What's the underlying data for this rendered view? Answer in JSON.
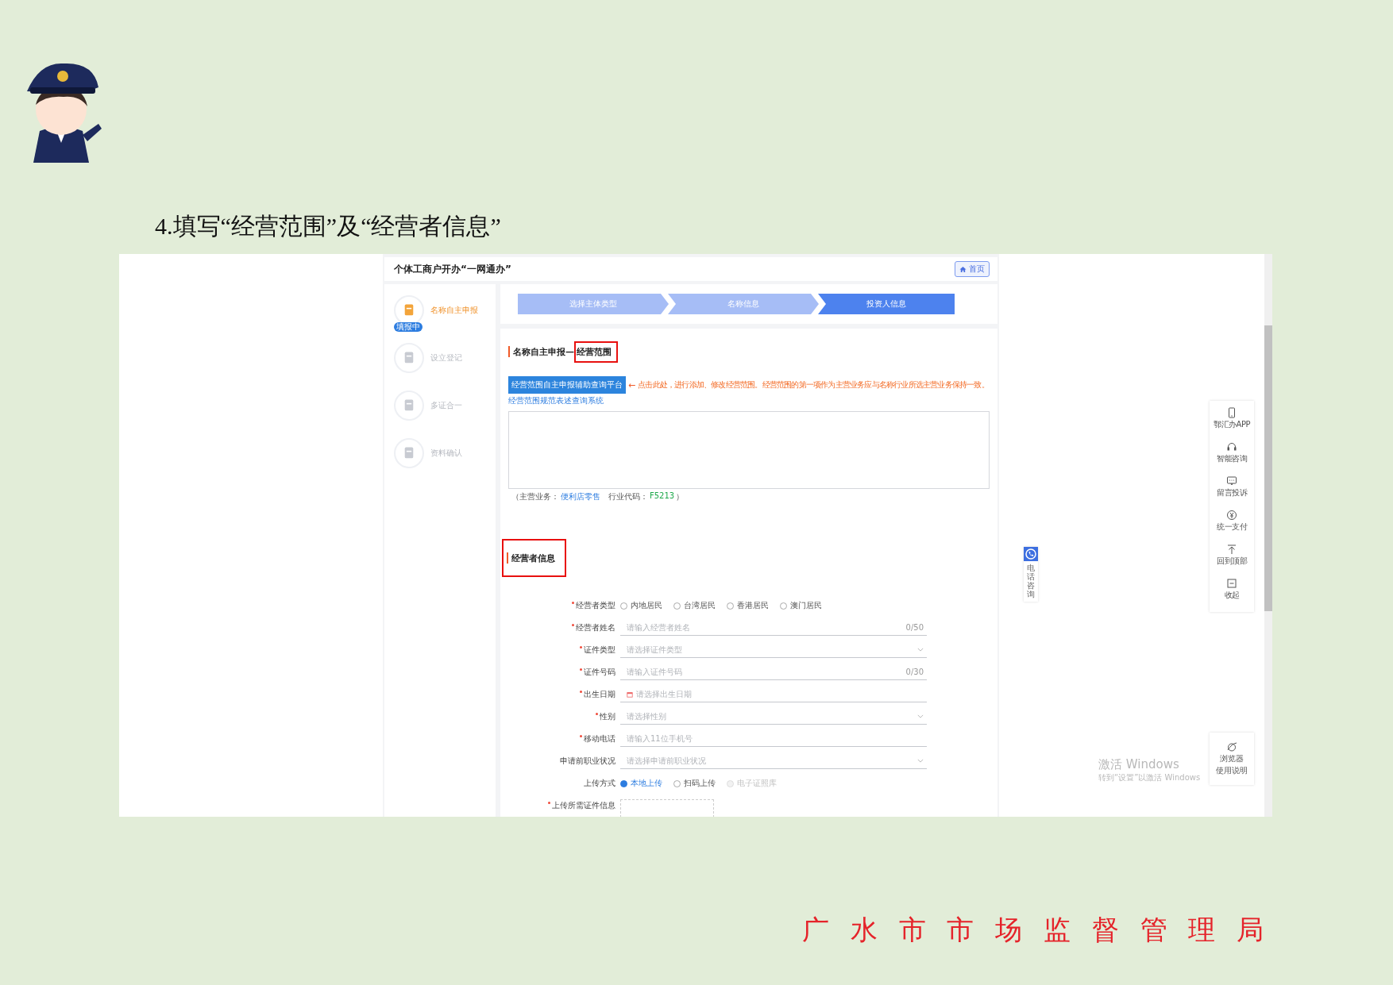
{
  "heading": "4.填写“经营范围”及“经营者信息”",
  "app": {
    "title": "个体工商户开办“一网通办”",
    "home_button": "首页",
    "nav": [
      {
        "label": "名称自主申报",
        "selected": true,
        "badge": "填报中"
      },
      {
        "label": "设立登记",
        "selected": false
      },
      {
        "label": "多证合一",
        "selected": false
      },
      {
        "label": "资料确认",
        "selected": false
      }
    ],
    "steps": [
      {
        "label": "选择主体类型",
        "current": false
      },
      {
        "label": "名称信息",
        "current": false
      },
      {
        "label": "投资人信息",
        "current": true
      }
    ],
    "scope_section": {
      "title": "名称自主申报—",
      "annotated_title": "经营范围",
      "platform_button": "经营范围自主申报辅助查询平台",
      "arrow": "←",
      "note": "点击此处，进行添加、修改经营范围。经营范围的第一项作为主营业务应与名称行业所选主营业务保持一致。",
      "link": "经营范围规范表述查询系统",
      "main_business_label": "（主营业务：",
      "main_business": "便利店零售",
      "industry_code_label": "行业代码：",
      "industry_code": "F5213",
      "industry_code_end": "）"
    },
    "operator_section": {
      "title": "经营者信息",
      "annotated": true,
      "fields": [
        {
          "kind": "radio",
          "label": "经营者类型",
          "required": true,
          "options": [
            {
              "label": "内地居民",
              "selected": false,
              "disabled": false
            },
            {
              "label": "台湾居民",
              "selected": false,
              "disabled": false
            },
            {
              "label": "香港居民",
              "selected": false,
              "disabled": false
            },
            {
              "label": "澳门居民",
              "selected": false,
              "disabled": false
            }
          ]
        },
        {
          "kind": "text",
          "label": "经营者姓名",
          "required": true,
          "placeholder": "请输入经营者姓名",
          "counter": "0/50"
        },
        {
          "kind": "select",
          "label": "证件类型",
          "required": true,
          "placeholder": "请选择证件类型"
        },
        {
          "kind": "text",
          "label": "证件号码",
          "required": true,
          "placeholder": "请输入证件号码",
          "counter": "0/30"
        },
        {
          "kind": "date",
          "label": "出生日期",
          "required": true,
          "placeholder": "请选择出生日期"
        },
        {
          "kind": "select",
          "label": "性别",
          "required": true,
          "placeholder": "请选择性别"
        },
        {
          "kind": "text",
          "label": "移动电话",
          "required": true,
          "placeholder": "请输入11位手机号"
        },
        {
          "kind": "select",
          "label": "申请前职业状况",
          "required": false,
          "placeholder": "请选择申请前职业状况"
        },
        {
          "kind": "radio",
          "label": "上传方式",
          "required": false,
          "options": [
            {
              "label": "本地上传",
              "selected": true,
              "disabled": false
            },
            {
              "label": "扫码上传",
              "selected": false,
              "disabled": false
            },
            {
              "label": "电子证照库",
              "selected": false,
              "disabled": true
            }
          ]
        },
        {
          "kind": "upload",
          "label": "上传所需证件信息",
          "required": true
        }
      ]
    },
    "phone_tab": "电话咨询",
    "toolbar": [
      {
        "kind": "phone",
        "label": "鄂汇办APP"
      },
      {
        "kind": "headset",
        "label": "智能咨询"
      },
      {
        "kind": "chat",
        "label": "留言投诉"
      },
      {
        "kind": "pay",
        "label": "统一支付"
      },
      {
        "kind": "top",
        "label": "回到顶部"
      },
      {
        "kind": "collapse",
        "label": "收起"
      }
    ],
    "browser_guide": [
      "浏览器",
      "使用说明"
    ],
    "windows_notice": {
      "title": "激活 Windows",
      "text": "转到“设置”以激活 Windows"
    }
  },
  "footer": "广 水 市 市 场 监 督 管 理 局"
}
